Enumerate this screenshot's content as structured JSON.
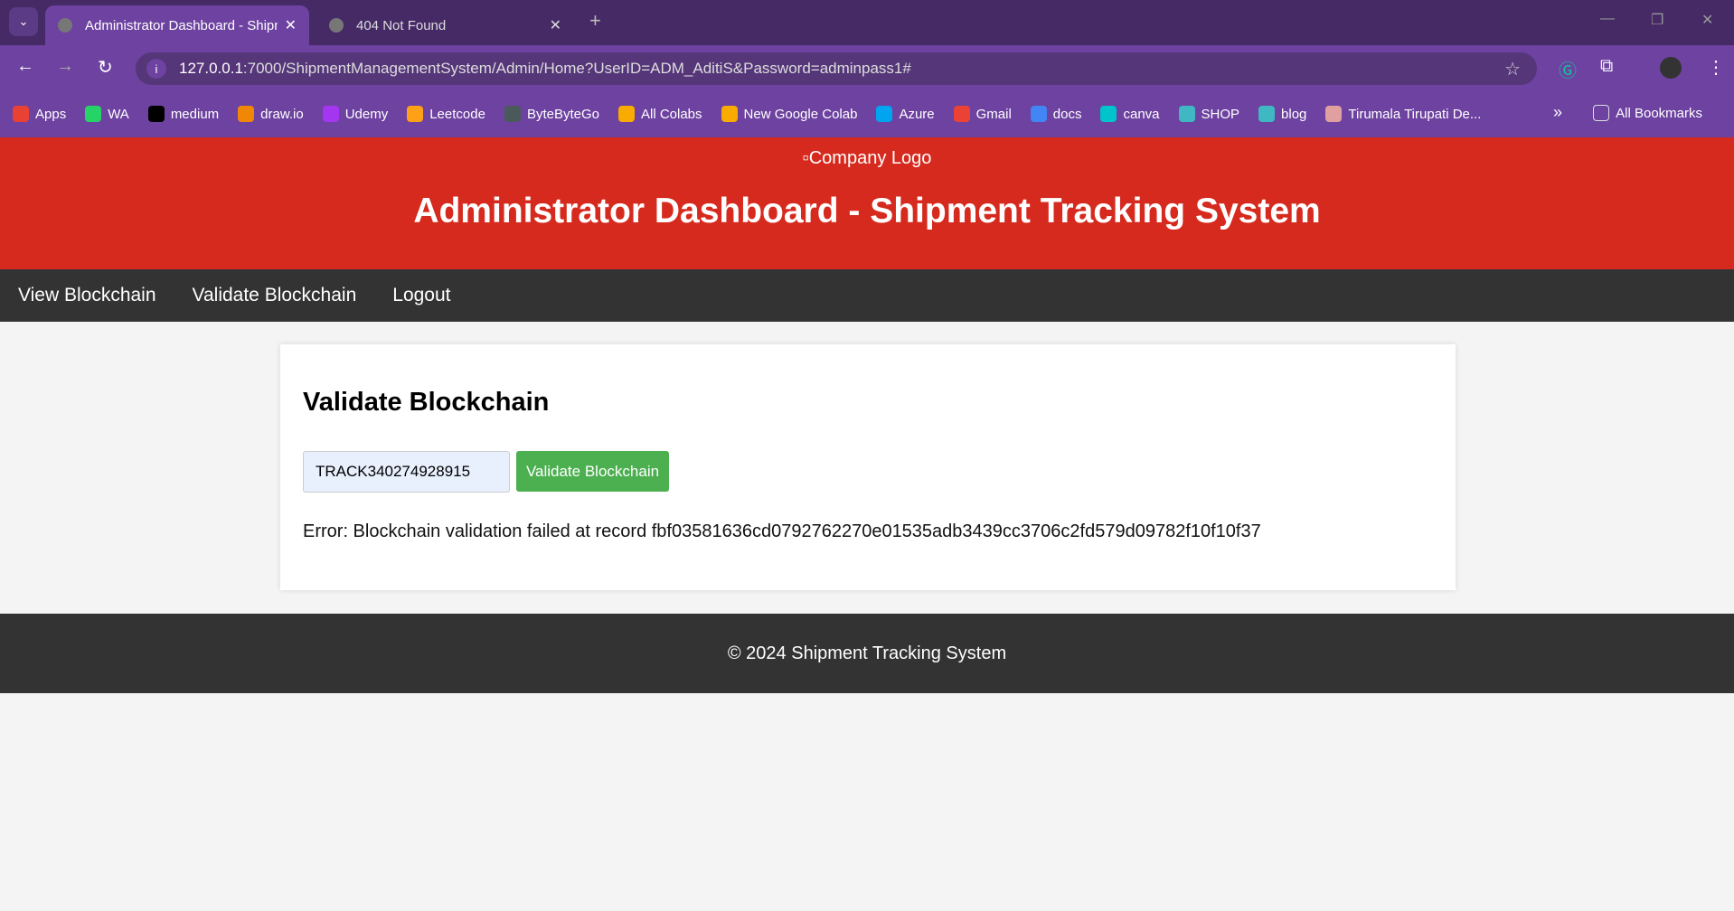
{
  "browser": {
    "tabs": [
      {
        "title": "Administrator Dashboard - Shipment Tracking System",
        "active": true
      },
      {
        "title": "404 Not Found",
        "active": false
      }
    ],
    "url_host": "127.0.0.1",
    "url_rest": ":7000/ShipmentManagementSystem/Admin/Home?UserID=ADM_AditiS&Password=adminpass1#",
    "bookmarks": [
      {
        "label": "Apps",
        "icon": "apps-grid-icon",
        "color": "#e94235"
      },
      {
        "label": "WA",
        "icon": "whatsapp-icon",
        "color": "#25d366"
      },
      {
        "label": "medium",
        "icon": "medium-icon",
        "color": "#000000"
      },
      {
        "label": "draw.io",
        "icon": "drawio-icon",
        "color": "#f08705"
      },
      {
        "label": "Udemy",
        "icon": "udemy-icon",
        "color": "#a435f0"
      },
      {
        "label": "Leetcode",
        "icon": "leetcode-icon",
        "color": "#ffa116"
      },
      {
        "label": "ByteByteGo",
        "icon": "bytebytego-icon",
        "color": "#4a5a5a"
      },
      {
        "label": "All Colabs",
        "icon": "colab-icon",
        "color": "#f9ab00"
      },
      {
        "label": "New Google Colab",
        "icon": "colab-icon",
        "color": "#f9ab00"
      },
      {
        "label": "Azure",
        "icon": "microsoft-icon",
        "color": "#00a4ef"
      },
      {
        "label": "Gmail",
        "icon": "gmail-icon",
        "color": "#ea4335"
      },
      {
        "label": "docs",
        "icon": "docs-icon",
        "color": "#4285f4"
      },
      {
        "label": "canva",
        "icon": "canva-icon",
        "color": "#00c4cc"
      },
      {
        "label": "SHOP",
        "icon": "shop-icon",
        "color": "#3fb8c4"
      },
      {
        "label": "blog",
        "icon": "blog-icon",
        "color": "#3fb8c4"
      },
      {
        "label": "Tirumala Tirupati De...",
        "icon": "temple-icon",
        "color": "#e0a0a0"
      }
    ],
    "all_bookmarks": "All Bookmarks"
  },
  "header": {
    "logo_alt": "Company Logo",
    "title": "Administrator Dashboard - Shipment Tracking System",
    "bg": "#d62a1e"
  },
  "nav": {
    "items": [
      "View Blockchain",
      "Validate Blockchain",
      "Logout"
    ]
  },
  "main": {
    "heading": "Validate Blockchain",
    "tracking_value": "TRACK340274928915",
    "button_label": "Validate Blockchain",
    "button_color": "#4caf50",
    "message": "Error: Blockchain validation failed at record fbf03581636cd0792762270e01535adb3439cc3706c2fd579d09782f10f10f37"
  },
  "footer": {
    "text": "© 2024 Shipment Tracking System"
  }
}
